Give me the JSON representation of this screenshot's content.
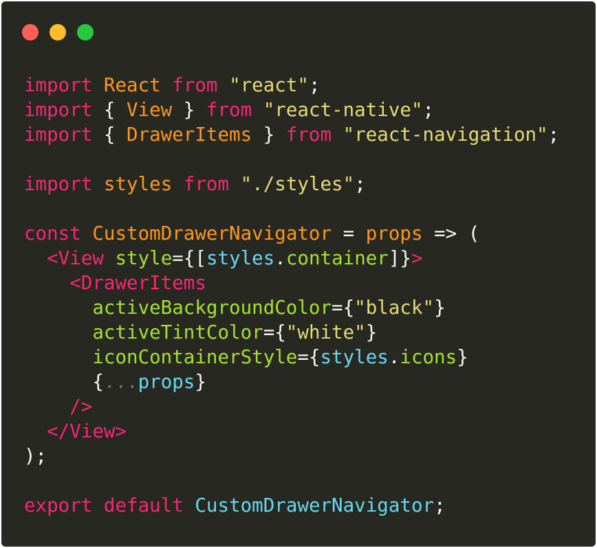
{
  "window": {
    "traffic_lights": [
      {
        "name": "close",
        "color": "#ff5f56"
      },
      {
        "name": "minimize",
        "color": "#ffbd2e"
      },
      {
        "name": "zoom",
        "color": "#27c93f"
      }
    ]
  },
  "theme": {
    "background": "#272822",
    "colors": {
      "kw": "#f92672",
      "id": "#fd971f",
      "str": "#e6db74",
      "p": "#f8f8f2",
      "fn": "#66d9ef",
      "attr": "#a6e22e",
      "cm": "#75715e"
    }
  },
  "code": {
    "lines": [
      [
        [
          "kw",
          "import"
        ],
        [
          "p",
          " "
        ],
        [
          "id",
          "React"
        ],
        [
          "p",
          " "
        ],
        [
          "kw",
          "from"
        ],
        [
          "p",
          " "
        ],
        [
          "str",
          "\"react\""
        ],
        [
          "p",
          ";"
        ]
      ],
      [
        [
          "kw",
          "import"
        ],
        [
          "p",
          " { "
        ],
        [
          "id",
          "View"
        ],
        [
          "p",
          " } "
        ],
        [
          "kw",
          "from"
        ],
        [
          "p",
          " "
        ],
        [
          "str",
          "\"react-native\""
        ],
        [
          "p",
          ";"
        ]
      ],
      [
        [
          "kw",
          "import"
        ],
        [
          "p",
          " { "
        ],
        [
          "id",
          "DrawerItems"
        ],
        [
          "p",
          " } "
        ],
        [
          "kw",
          "from"
        ],
        [
          "p",
          " "
        ],
        [
          "str",
          "\"react-navigation\""
        ],
        [
          "p",
          ";"
        ]
      ],
      [],
      [
        [
          "kw",
          "import"
        ],
        [
          "p",
          " "
        ],
        [
          "id",
          "styles"
        ],
        [
          "p",
          " "
        ],
        [
          "kw",
          "from"
        ],
        [
          "p",
          " "
        ],
        [
          "str",
          "\"./styles\""
        ],
        [
          "p",
          ";"
        ]
      ],
      [],
      [
        [
          "kw",
          "const"
        ],
        [
          "p",
          " "
        ],
        [
          "id",
          "CustomDrawerNavigator"
        ],
        [
          "p",
          " = "
        ],
        [
          "id",
          "props"
        ],
        [
          "p",
          " => ("
        ]
      ],
      [
        [
          "p",
          "  "
        ],
        [
          "kw",
          "<View"
        ],
        [
          "p",
          " "
        ],
        [
          "attr",
          "style"
        ],
        [
          "p",
          "={["
        ],
        [
          "fn",
          "styles"
        ],
        [
          "p",
          "."
        ],
        [
          "attr",
          "container"
        ],
        [
          "p",
          "]}"
        ],
        [
          "kw",
          ">"
        ]
      ],
      [
        [
          "p",
          "    "
        ],
        [
          "kw",
          "<DrawerItems"
        ]
      ],
      [
        [
          "p",
          "      "
        ],
        [
          "attr",
          "activeBackgroundColor"
        ],
        [
          "p",
          "={"
        ],
        [
          "str",
          "\"black\""
        ],
        [
          "p",
          "}"
        ]
      ],
      [
        [
          "p",
          "      "
        ],
        [
          "attr",
          "activeTintColor"
        ],
        [
          "p",
          "={"
        ],
        [
          "str",
          "\"white\""
        ],
        [
          "p",
          "}"
        ]
      ],
      [
        [
          "p",
          "      "
        ],
        [
          "attr",
          "iconContainerStyle"
        ],
        [
          "p",
          "={"
        ],
        [
          "fn",
          "styles"
        ],
        [
          "p",
          "."
        ],
        [
          "attr",
          "icons"
        ],
        [
          "p",
          "}"
        ]
      ],
      [
        [
          "p",
          "      {"
        ],
        [
          "cm",
          "..."
        ],
        [
          "fn",
          "props"
        ],
        [
          "p",
          "}"
        ]
      ],
      [
        [
          "p",
          "    "
        ],
        [
          "kw",
          "/>"
        ]
      ],
      [
        [
          "p",
          "  "
        ],
        [
          "kw",
          "</View>"
        ]
      ],
      [
        [
          "p",
          ");"
        ]
      ],
      [],
      [
        [
          "kw",
          "export"
        ],
        [
          "p",
          " "
        ],
        [
          "kw",
          "default"
        ],
        [
          "p",
          " "
        ],
        [
          "fn",
          "CustomDrawerNavigator"
        ],
        [
          "p",
          ";"
        ]
      ]
    ]
  }
}
